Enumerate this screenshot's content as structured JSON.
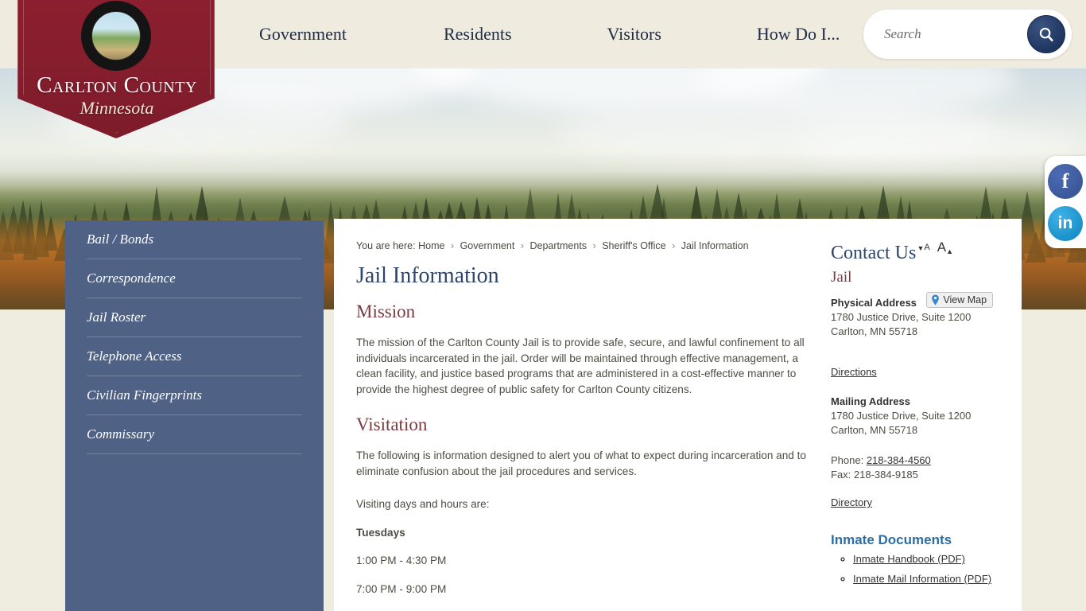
{
  "header": {
    "logo": {
      "county_name": "Carlton County",
      "state_name": "Minnesota",
      "seal_top_text": "CARLTON COUNTY",
      "seal_bottom_text": "MINNESOTA"
    },
    "nav": [
      {
        "label": "Government"
      },
      {
        "label": "Residents"
      },
      {
        "label": "Visitors"
      },
      {
        "label": "How Do I..."
      }
    ],
    "search": {
      "placeholder": "Search",
      "value": "",
      "icon": "search-icon"
    }
  },
  "sidebar": {
    "items": [
      {
        "label": "Bail / Bonds"
      },
      {
        "label": "Correspondence"
      },
      {
        "label": "Jail Roster"
      },
      {
        "label": "Telephone Access"
      },
      {
        "label": "Civilian Fingerprints"
      },
      {
        "label": "Commissary"
      }
    ]
  },
  "breadcrumb": {
    "prefix": "You are here:",
    "separator": "›",
    "items": [
      "Home",
      "Government",
      "Departments",
      "Sheriff's Office",
      "Jail Information"
    ]
  },
  "fontsize_controls": {
    "decrease_label": "A",
    "decrease_icon": "triangle-down-icon",
    "increase_label": "A",
    "increase_icon": "triangle-up-icon"
  },
  "main": {
    "page_title": "Jail Information",
    "sections": [
      {
        "heading": "Mission",
        "paragraphs": [
          "The mission of the Carlton County Jail is to provide safe, secure, and lawful confinement to all individuals incarcerated in the jail. Order will be maintained through effective management, a clean facility, and justice based programs that are administered in a cost-effective manner to provide the highest degree of public safety for Carlton County citizens."
        ]
      },
      {
        "heading": "Visitation",
        "paragraphs": [
          "The following is information designed to alert you of what to expect during incarceration and to eliminate confusion about the jail procedures and services.",
          "Visiting days and hours are:"
        ],
        "schedule_day": "Tuesdays",
        "schedule_times": [
          "1:00 PM - 4:30 PM",
          "7:00 PM - 9:00 PM"
        ]
      }
    ]
  },
  "contact": {
    "title": "Contact Us",
    "department": "Jail",
    "physical_address_label": "Physical Address",
    "view_map_label": "View Map",
    "view_map_icon": "map-pin-icon",
    "physical_address_line1": "1780 Justice Drive, Suite 1200",
    "physical_address_line2": "Carlton, MN 55718",
    "directions_label": "Directions",
    "mailing_address_label": "Mailing Address",
    "mailing_address_line1": "1780 Justice Drive, Suite 1200",
    "mailing_address_line2": "Carlton, MN 55718",
    "phone_label": "Phone:",
    "phone_value": "218-384-4560",
    "fax_line": "Fax: 218-384-9185",
    "directory_label": "Directory"
  },
  "inmate_documents": {
    "title": "Inmate Documents",
    "links": [
      {
        "label": "Inmate Handbook (PDF)"
      },
      {
        "label": "Inmate Mail Information (PDF)"
      }
    ]
  },
  "social": [
    {
      "name": "facebook",
      "glyph": "f"
    },
    {
      "name": "linkedin",
      "glyph": "in"
    }
  ],
  "colors": {
    "brand_maroon": "#8c1f2f",
    "nav_navy": "#2d456b",
    "sidebar_slate": "#4f6285",
    "heading_rust": "#7a3b3f",
    "docs_blue": "#2d6ea3",
    "page_cream": "#efece0"
  }
}
